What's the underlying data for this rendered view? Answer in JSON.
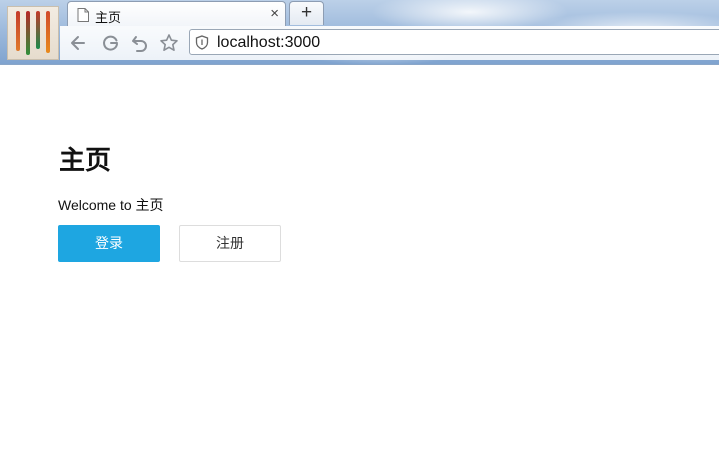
{
  "browser": {
    "tab_title": "主页",
    "tab_close_glyph": "×",
    "new_tab_glyph": "+",
    "url": "localhost:3000"
  },
  "page": {
    "title": "主页",
    "welcome": "Welcome to 主页",
    "login_label": "登录",
    "register_label": "注册"
  },
  "colors": {
    "primary_button": "#1ea6e1",
    "secondary_button_border": "#dddddd"
  },
  "icons": [
    "document-icon",
    "back-icon",
    "reload-icon",
    "undo-icon",
    "star-icon",
    "shield-icon"
  ]
}
